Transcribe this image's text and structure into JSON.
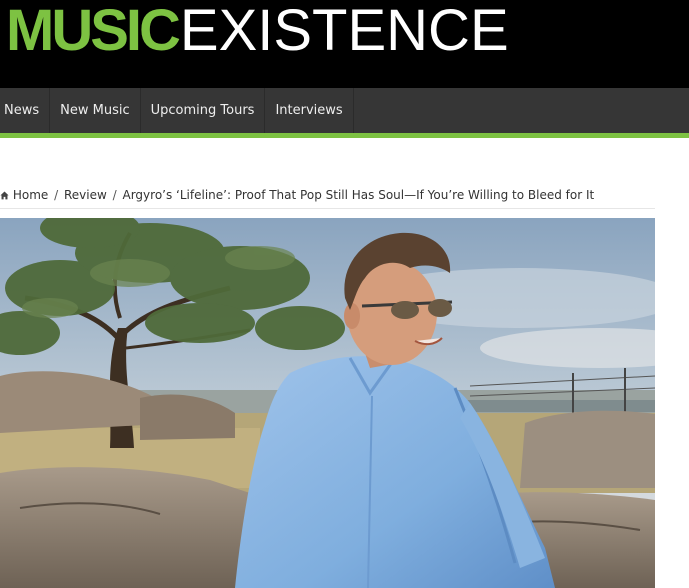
{
  "site": {
    "logo_bold": "MUSIC",
    "logo_light": "EXISTENCE",
    "brand_color": "#7dc242"
  },
  "nav": {
    "items": [
      {
        "label": "News"
      },
      {
        "label": "New Music"
      },
      {
        "label": "Upcoming Tours"
      },
      {
        "label": "Interviews"
      }
    ]
  },
  "breadcrumb": {
    "home_icon": "home-icon",
    "home": "Home",
    "section": "Review",
    "current": "Argyro’s ‘Lifeline’: Proof That Pop Still Has Soul—If You’re Willing to Bleed for It",
    "separator": "/"
  }
}
